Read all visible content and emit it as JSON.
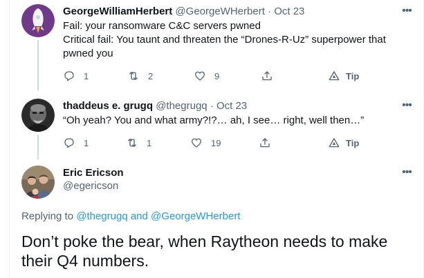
{
  "tweets": [
    {
      "name": "GeorgeWilliamHerbert",
      "handle": "@GeorgeWHerbert",
      "separator": "·",
      "date": "Oct 23",
      "lines": [
        "Fail: your ransomware C&C servers pwned",
        "Critical fail: You taunt and threaten the “Drones-R-Uz” superpower that",
        "pwned you"
      ],
      "replies": "1",
      "retweets": "2",
      "likes": "9",
      "tip": "Tip"
    },
    {
      "name": "thaddeus e. grugq",
      "handle": "@thegrugq",
      "separator": "·",
      "date": "Oct 23",
      "lines": [
        "“Oh yeah? You and what army?!?… ah, I see… right, well then…”"
      ],
      "replies": "1",
      "retweets": "1",
      "likes": "19",
      "tip": "Tip"
    }
  ],
  "main_tweet": {
    "name": "Eric Ericson",
    "handle": "@egericson",
    "replying_prefix": "Replying to",
    "replying_user1": "@thegrugq",
    "replying_and": "and",
    "replying_user2": "@GeorgeWHerbert",
    "text_line1": "Don’t poke the bear, when Raytheon needs to make",
    "text_line2": "their Q4 numbers."
  },
  "colors": {
    "text": "#0f1419",
    "secondary": "#536471",
    "link": "#1d9bf0",
    "thread_line": "#cfd9de"
  },
  "icons": [
    "more-icon",
    "reply-icon",
    "retweet-icon",
    "like-icon",
    "share-icon",
    "tip-icon"
  ]
}
